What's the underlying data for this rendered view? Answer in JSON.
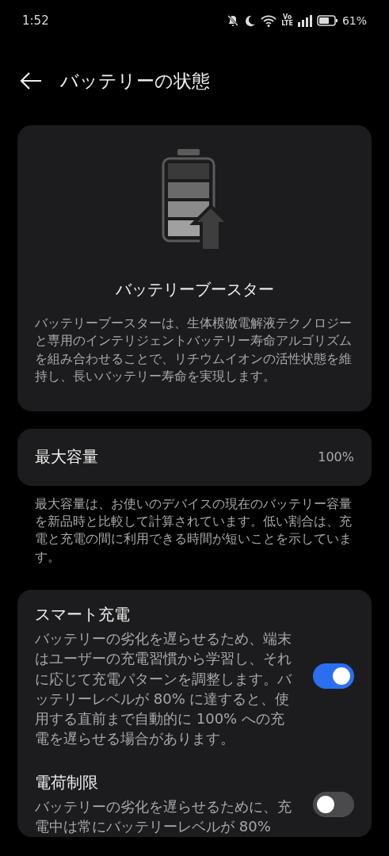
{
  "status_bar": {
    "time": "1:52",
    "volte_top": "Vo",
    "volte_bottom": "LTE",
    "battery": "61%"
  },
  "header": {
    "title": "バッテリーの状態"
  },
  "booster": {
    "title": "バッテリーブースター",
    "description": "バッテリーブースターは、生体模倣電解液テクノロジーと専用のインテリジェントバッテリー寿命アルゴリズムを組み合わせることで、リチウムイオンの活性状態を維持し、長いバッテリー寿命を実現します。"
  },
  "capacity": {
    "label": "最大容量",
    "value": "100%",
    "note": "最大容量は、お使いのデバイスの現在のバッテリー容量を新品時と比較して計算されています。低い割合は、充電と充電の間に利用できる時間が短いことを示しています。"
  },
  "settings": [
    {
      "title": "スマート充電",
      "description": "バッテリーの劣化を遅らせるため、端末はユーザーの充電習慣から学習し、それに応じて充電パターンを調整します。バッテリーレベルが 80% に達すると、使用する直前まで自動的に 100% への充電を遅らせる場合があります。",
      "on": true
    },
    {
      "title": "電荷制限",
      "description": "バッテリーの劣化を遅らせるために、充電中は常にバッテリーレベルが 80%",
      "on": false
    }
  ]
}
